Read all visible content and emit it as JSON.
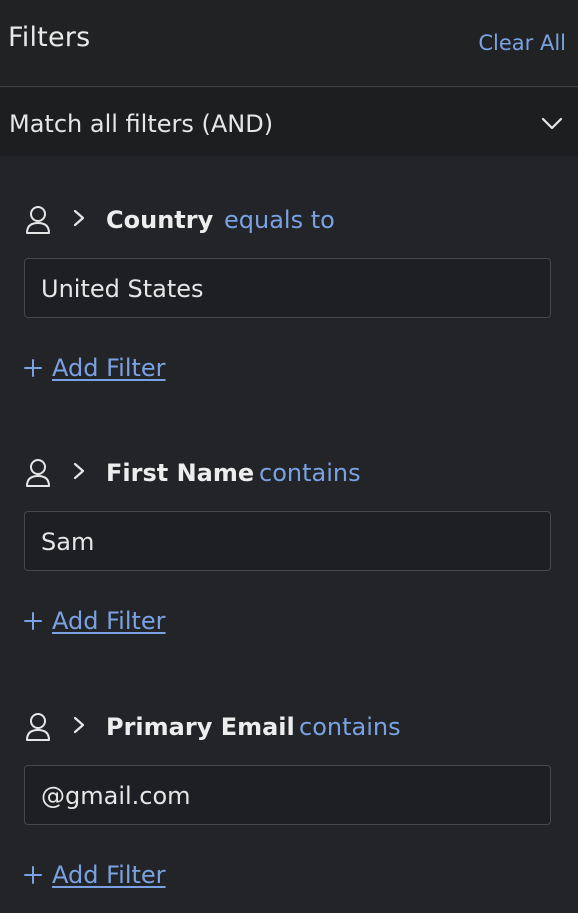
{
  "header": {
    "title": "Filters",
    "clear_all_label": "Clear All"
  },
  "match_mode": {
    "label": "Match all filters (AND)"
  },
  "filters": [
    {
      "field": "Country",
      "operator": "equals to",
      "value": "United States",
      "add_label": "Add Filter"
    },
    {
      "field": "First Name",
      "operator": "contains",
      "value": "Sam",
      "add_label": "Add Filter"
    },
    {
      "field": "Primary Email",
      "operator": "contains",
      "value": "@gmail.com",
      "add_label": "Add Filter"
    }
  ],
  "icons": {
    "person": "person-icon",
    "expand": "chevron-right-icon",
    "dropdown": "chevron-down-icon",
    "add": "plus-icon"
  },
  "colors": {
    "accent": "#7aa2e3",
    "background": "#222427",
    "header": "#212224"
  }
}
